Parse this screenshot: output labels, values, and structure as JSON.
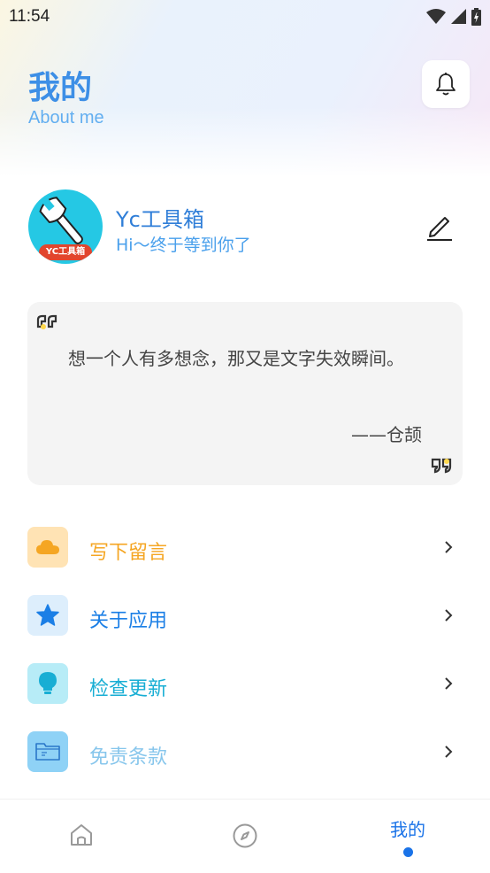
{
  "status_bar": {
    "time": "11:54",
    "icons": [
      "wifi-icon",
      "signal-icon",
      "battery-charging-icon"
    ]
  },
  "header": {
    "title": "我的",
    "subtitle": "About me",
    "notification_icon": "bell-icon"
  },
  "profile": {
    "avatar_label": "YC工具箱",
    "name": "Yc工具箱",
    "greeting": "Hi～终于等到你了",
    "edit_icon": "edit-icon"
  },
  "quote": {
    "text": "想一个人有多想念，那又是文字失效瞬间。",
    "author": "——仓颉"
  },
  "menu": [
    {
      "label": "写下留言",
      "icon": "cloud-icon",
      "color": "#f5a623",
      "icon_bg": "#ffe3b4"
    },
    {
      "label": "关于应用",
      "icon": "star-icon",
      "color": "#1b7fe6",
      "icon_bg": "#ddeefc"
    },
    {
      "label": "检查更新",
      "icon": "lightbulb-icon",
      "color": "#18aed4",
      "icon_bg": "#b7ecf7"
    },
    {
      "label": "免责条款",
      "icon": "folder-icon",
      "color": "#87c6ec",
      "icon_bg": "#8fd2f6"
    }
  ],
  "bottom_nav": {
    "items": [
      "home-icon",
      "compass-icon"
    ],
    "active_label": "我的",
    "active_color": "#1a73e8"
  }
}
